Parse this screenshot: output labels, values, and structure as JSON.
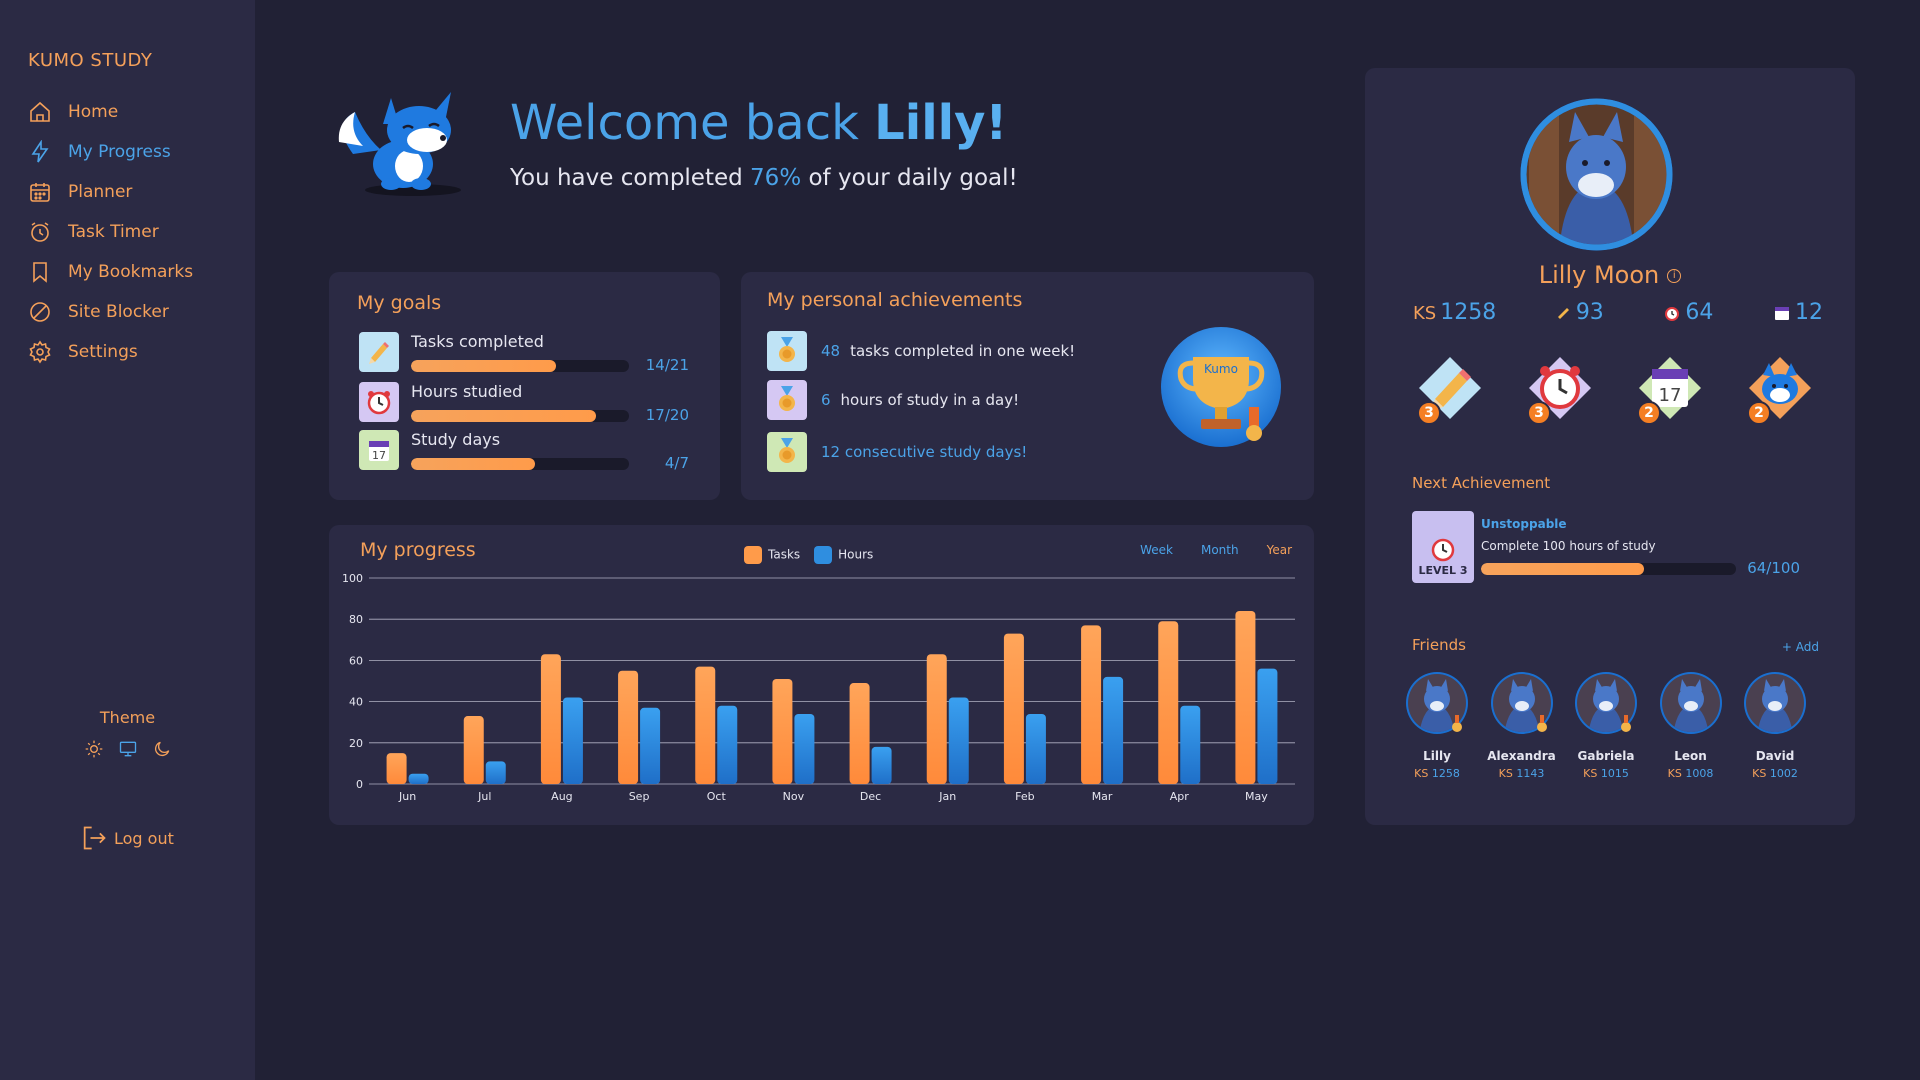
{
  "app": {
    "brand": "KUMO STUDY"
  },
  "sidebar": {
    "items": [
      {
        "label": "Home",
        "icon": "home-icon"
      },
      {
        "label": "My Progress",
        "icon": "lightning-icon",
        "active": true
      },
      {
        "label": "Planner",
        "icon": "calendar-icon"
      },
      {
        "label": "Task Timer",
        "icon": "timer-icon"
      },
      {
        "label": "My Bookmarks",
        "icon": "bookmark-icon"
      },
      {
        "label": "Site Blocker",
        "icon": "block-icon"
      },
      {
        "label": "Settings",
        "icon": "gear-icon"
      }
    ],
    "theme_label": "Theme",
    "theme_options": [
      "sun-icon",
      "monitor-icon",
      "moon-icon"
    ],
    "logout_label": "Log out"
  },
  "welcome": {
    "title_prefix": "Welcome back ",
    "name": "Lilly!",
    "sub_prefix": "You have completed ",
    "percent": "76%",
    "sub_suffix": " of your daily goal!"
  },
  "goals": {
    "title": "My goals",
    "items": [
      {
        "label": "Tasks completed",
        "value": "14/21",
        "fraction": 0.667,
        "icon": "pencil-icon",
        "bg": "#bfe3f5"
      },
      {
        "label": "Hours studied",
        "value": "17/20",
        "fraction": 0.85,
        "icon": "clock-icon",
        "bg": "#d5c8f3"
      },
      {
        "label": "Study days",
        "value": "4/7",
        "fraction": 0.571,
        "icon": "calendar-17-icon",
        "bg": "#cfe8b5"
      }
    ]
  },
  "achievements": {
    "title": "My personal achievements",
    "items": [
      {
        "num": "48",
        "text": "tasks completed in one week!",
        "bg": "#bfe3f5"
      },
      {
        "num": "6",
        "text": "hours of study in a day!",
        "bg": "#d5c8f3"
      },
      {
        "num": "",
        "text": "12 consecutive study days!",
        "bg": "#cfe8b5"
      }
    ],
    "trophy_label": "Kumo"
  },
  "progress": {
    "title": "My progress",
    "legend_tasks": "Tasks",
    "legend_hours": "Hours",
    "periods": [
      "Week",
      "Month",
      "Year"
    ],
    "selected_period": "Year"
  },
  "chart_data": {
    "type": "bar",
    "categories": [
      "Jun",
      "Jul",
      "Aug",
      "Sep",
      "Oct",
      "Nov",
      "Dec",
      "Jan",
      "Feb",
      "Mar",
      "Apr",
      "May"
    ],
    "series": [
      {
        "name": "Tasks",
        "values": [
          15,
          33,
          63,
          55,
          57,
          51,
          49,
          63,
          73,
          77,
          79,
          84
        ],
        "color": "#ff9b4a"
      },
      {
        "name": "Hours",
        "values": [
          5,
          11,
          42,
          37,
          38,
          34,
          18,
          42,
          34,
          52,
          38,
          56
        ],
        "color": "#2f8ee0"
      }
    ],
    "yticks": [
      "0",
      "20",
      "40",
      "60",
      "80",
      "100"
    ],
    "ylim": [
      0,
      100
    ],
    "grid": true,
    "legend": "top-center"
  },
  "profile": {
    "name": "Lilly Moon",
    "ks_label": "KS",
    "ks": "1258",
    "stat_tasks": "93",
    "stat_timer": "64",
    "stat_days": "12",
    "badges": [
      {
        "icon": "pencil-badge-icon",
        "count": "3"
      },
      {
        "icon": "clock-badge-icon",
        "count": "3"
      },
      {
        "icon": "calendar-badge-icon",
        "count": "2"
      },
      {
        "icon": "fox-badge-icon",
        "count": "2"
      }
    ],
    "next_achievement_label": "Next Achievement",
    "next_achievement": {
      "level": "LEVEL 3",
      "title": "Unstoppable",
      "desc": "Complete 100 hours of study",
      "value": "64/100",
      "fraction": 0.64
    },
    "friends_label": "Friends",
    "add_label": "+ Add",
    "friends": [
      {
        "name": "Lilly",
        "ks": "1258"
      },
      {
        "name": "Alexandra",
        "ks": "1143"
      },
      {
        "name": "Gabriela",
        "ks": "1015"
      },
      {
        "name": "Leon",
        "ks": "1008"
      },
      {
        "name": "David",
        "ks": "1002"
      }
    ]
  }
}
